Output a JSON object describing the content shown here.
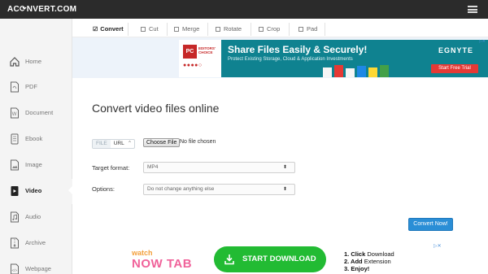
{
  "app": {
    "logo_text": "AC⟳NVERT.COM"
  },
  "sidebar": {
    "items": [
      {
        "label": "Home",
        "icon": "home-icon"
      },
      {
        "label": "PDF",
        "icon": "pdf-icon"
      },
      {
        "label": "Document",
        "icon": "document-icon"
      },
      {
        "label": "Ebook",
        "icon": "ebook-icon"
      },
      {
        "label": "Image",
        "icon": "image-icon"
      },
      {
        "label": "Video",
        "icon": "video-icon",
        "active": true
      },
      {
        "label": "Audio",
        "icon": "audio-icon"
      },
      {
        "label": "Archive",
        "icon": "archive-icon"
      },
      {
        "label": "Webpage",
        "icon": "webpage-icon"
      }
    ]
  },
  "tabs": [
    {
      "label": "Convert",
      "active": true
    },
    {
      "label": "Cut"
    },
    {
      "label": "Merge"
    },
    {
      "label": "Rotate"
    },
    {
      "label": "Crop"
    },
    {
      "label": "Pad"
    }
  ],
  "top_ad": {
    "badge": "PC",
    "badge_text": "EDITORS' CHOICE",
    "title": "Share Files Easily & Securely!",
    "subtitle": "Protect Existing Storage, Cloud & Application Investments",
    "brand": "EGNYTE",
    "cta": "Start Free Trial",
    "close_label": "▷✕"
  },
  "main": {
    "title": "Convert video files online",
    "source_toggle": {
      "file": "FILE",
      "url": "URL",
      "caret": "⌃"
    },
    "choose_button": "Choose File",
    "no_file_text": "No file chosen",
    "target_format_label": "Target format:",
    "target_format_value": "MP4",
    "options_label": "Options:",
    "options_value": "Do not change anything else",
    "select_arrow": "⬍",
    "convert_button": "Convert Now!"
  },
  "bottom_ad": {
    "watch": "watch",
    "now_tab": "NOW TAB",
    "download_button": "START DOWNLOAD",
    "step1_num": "1. Click",
    "step1_text": "Download",
    "step2_num": "2. Add",
    "step2_text": "Extension",
    "step3_num": "3. Enjoy!",
    "close_label": "▷✕"
  },
  "colors": {
    "topbar": "#2b2b2b",
    "accent_blue": "#2a8ed6",
    "ad_teal": "#0f8290",
    "download_green": "#22bb33"
  }
}
